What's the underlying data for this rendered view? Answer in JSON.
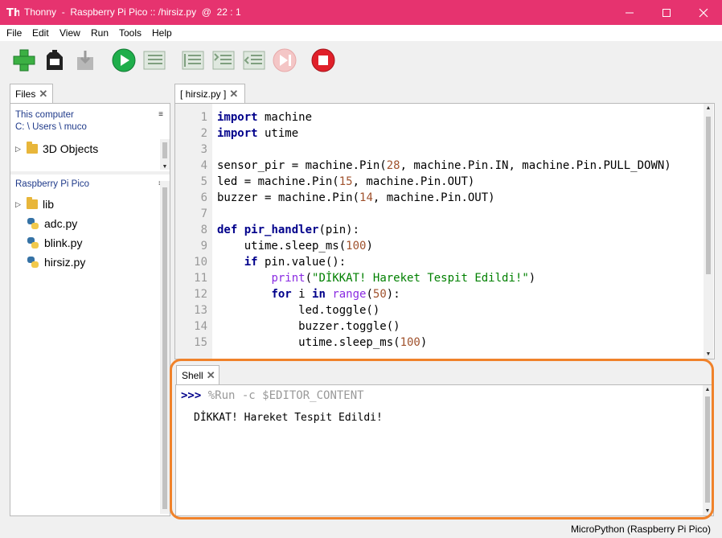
{
  "window": {
    "title": "Thonny  -  Raspberry Pi Pico :: /hirsiz.py  @  22 : 1",
    "accent_color": "#e6336f"
  },
  "menu": [
    "File",
    "Edit",
    "View",
    "Run",
    "Tools",
    "Help"
  ],
  "toolbar_icons": [
    "new-file-icon",
    "open-file-icon",
    "save-file-icon",
    "run-icon",
    "debug-icon",
    "step-over-icon",
    "step-into-icon",
    "step-out-icon",
    "resume-icon",
    "stop-icon"
  ],
  "files_panel": {
    "tab_label": "Files",
    "computer": {
      "title": "This computer",
      "path": [
        "C:",
        "Users",
        "muco"
      ],
      "items": [
        {
          "name": "3D Objects",
          "type": "folder",
          "expandable": true
        }
      ]
    },
    "pico": {
      "title": "Raspberry Pi Pico",
      "items": [
        {
          "name": "lib",
          "type": "folder",
          "expandable": true
        },
        {
          "name": "adc.py",
          "type": "python"
        },
        {
          "name": "blink.py",
          "type": "python"
        },
        {
          "name": "hirsiz.py",
          "type": "python"
        }
      ]
    }
  },
  "editor": {
    "tab_label": "[ hirsiz.py ]",
    "line_numbers": [
      "1",
      "2",
      "3",
      "4",
      "5",
      "6",
      "7",
      "8",
      "9",
      "10",
      "11",
      "12",
      "13",
      "14",
      "15"
    ],
    "lines": [
      [
        {
          "t": "import",
          "c": "kw"
        },
        {
          "t": " machine"
        }
      ],
      [
        {
          "t": "import",
          "c": "kw"
        },
        {
          "t": " utime"
        }
      ],
      [],
      [
        {
          "t": "sensor_pir = machine.Pin("
        },
        {
          "t": "28",
          "c": "num"
        },
        {
          "t": ", machine.Pin.IN, machine.Pin.PULL_DOWN)"
        }
      ],
      [
        {
          "t": "led = machine.Pin("
        },
        {
          "t": "15",
          "c": "num"
        },
        {
          "t": ", machine.Pin.OUT)"
        }
      ],
      [
        {
          "t": "buzzer = machine.Pin("
        },
        {
          "t": "14",
          "c": "num"
        },
        {
          "t": ", machine.Pin.OUT)"
        }
      ],
      [],
      [
        {
          "t": "def",
          "c": "kw"
        },
        {
          "t": " "
        },
        {
          "t": "pir_handler",
          "c": "fn"
        },
        {
          "t": "(pin):"
        }
      ],
      [
        {
          "t": "    utime.sleep_ms("
        },
        {
          "t": "100",
          "c": "num"
        },
        {
          "t": ")"
        }
      ],
      [
        {
          "t": "    "
        },
        {
          "t": "if",
          "c": "kw"
        },
        {
          "t": " pin.value():"
        }
      ],
      [
        {
          "t": "        "
        },
        {
          "t": "print",
          "c": "bi"
        },
        {
          "t": "("
        },
        {
          "t": "\"DİKKAT! Hareket Tespit Edildi!\"",
          "c": "str"
        },
        {
          "t": ")"
        }
      ],
      [
        {
          "t": "        "
        },
        {
          "t": "for",
          "c": "kw"
        },
        {
          "t": " i "
        },
        {
          "t": "in",
          "c": "kw"
        },
        {
          "t": " "
        },
        {
          "t": "range",
          "c": "bi"
        },
        {
          "t": "("
        },
        {
          "t": "50",
          "c": "num"
        },
        {
          "t": "):"
        }
      ],
      [
        {
          "t": "            led.toggle()"
        }
      ],
      [
        {
          "t": "            buzzer.toggle()"
        }
      ],
      [
        {
          "t": "            utime.sleep_ms("
        },
        {
          "t": "100",
          "c": "num"
        },
        {
          "t": ")"
        }
      ]
    ]
  },
  "shell": {
    "tab_label": "Shell",
    "prompt": ">>>",
    "command": " %Run -c $EDITOR_CONTENT",
    "output": "DİKKAT! Hareket Tespit Edildi!",
    "highlight_color": "#f0822a"
  },
  "status_bar": {
    "interpreter": "MicroPython (Raspberry Pi Pico)"
  }
}
